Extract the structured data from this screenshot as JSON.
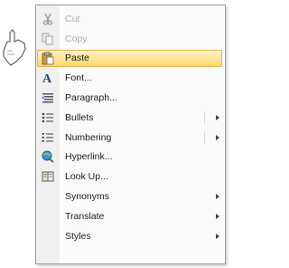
{
  "menu": {
    "items": [
      {
        "label": "Cut",
        "icon": "scissors-icon",
        "state": "disabled"
      },
      {
        "label": "Copy",
        "icon": "copy-icon",
        "state": "disabled"
      },
      {
        "label": "Paste",
        "icon": "paste-icon",
        "state": "highlighted"
      },
      {
        "label": "Font...",
        "icon": "font-icon",
        "state": "normal"
      },
      {
        "label": "Paragraph...",
        "icon": "paragraph-icon",
        "state": "normal"
      },
      {
        "label": "Bullets",
        "icon": "bullets-icon",
        "state": "normal",
        "submenu": true
      },
      {
        "label": "Numbering",
        "icon": "numbering-icon",
        "state": "normal",
        "submenu": true
      },
      {
        "label": "Hyperlink...",
        "icon": "hyperlink-icon",
        "state": "normal"
      },
      {
        "label": "Look Up...",
        "icon": "lookup-icon",
        "state": "normal"
      },
      {
        "label": "Synonyms",
        "icon": "",
        "state": "normal",
        "submenu": true
      },
      {
        "label": "Translate",
        "icon": "",
        "state": "normal",
        "submenu": true
      },
      {
        "label": "Styles",
        "icon": "",
        "state": "normal",
        "submenu": true
      }
    ]
  },
  "colors": {
    "highlight_top": "#fff3c7",
    "highlight_bottom": "#ffd76d",
    "highlight_border": "#e3b24a",
    "gutter": "#f0f0f0",
    "disabled_text": "#a9a9a9"
  }
}
